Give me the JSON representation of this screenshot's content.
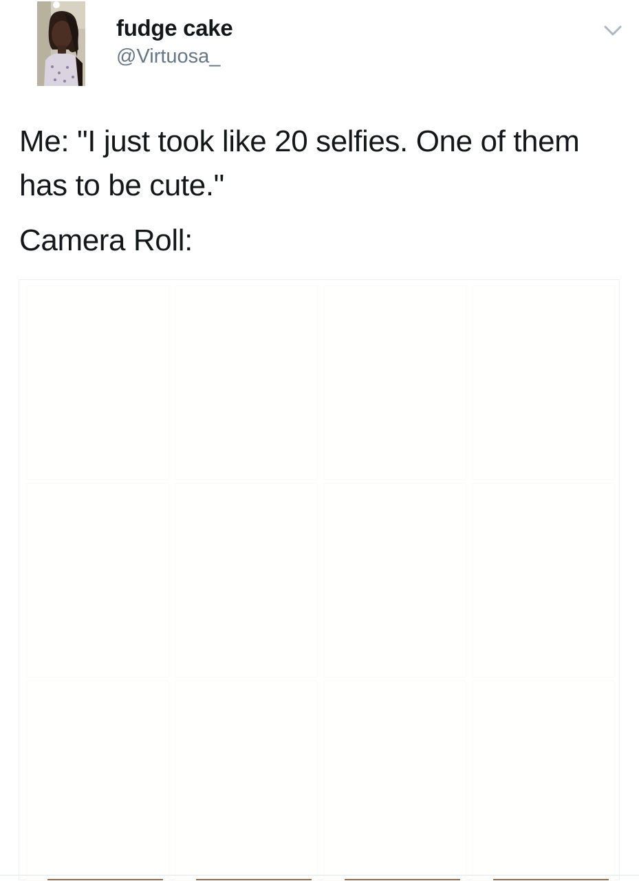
{
  "tweet": {
    "display_name": "fudge cake",
    "handle": "@Virtuosa_",
    "text_line_1": "Me: \"I just took like 20 selfies. One of them has to be cute.\"",
    "text_line_2": "Camera Roll:",
    "menu_icon": "chevron-down-icon"
  },
  "media": {
    "thumbnail_count": 12,
    "thumbnails": [
      "",
      "",
      "",
      "",
      "",
      "",
      "",
      "",
      "",
      "",
      "",
      ""
    ]
  },
  "colors": {
    "text": "#14171a",
    "handle": "#657786",
    "chevron": "#aab8c2",
    "border": "#e1e8ed"
  }
}
